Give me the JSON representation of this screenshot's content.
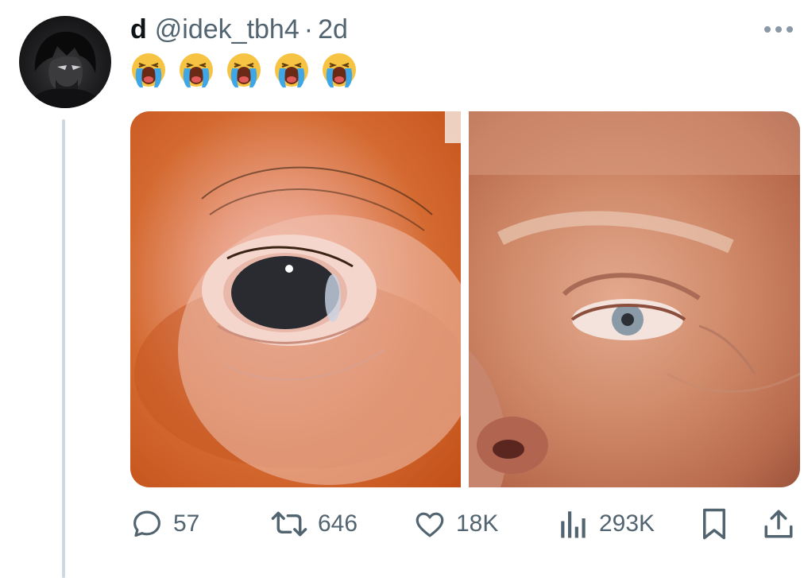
{
  "tweet": {
    "display_name": "d",
    "handle": "@idek_tbh4",
    "separator": "·",
    "time": "2d",
    "emojis": [
      "😭",
      "😭",
      "😭",
      "😭",
      "😭"
    ]
  },
  "actions": {
    "replies": "57",
    "reposts": "646",
    "likes": "18K",
    "views": "293K"
  },
  "colors": {
    "secondary_text": "#536471",
    "thread_line": "#cfd9de"
  },
  "icons": [
    "more-icon",
    "reply-icon",
    "repost-icon",
    "like-icon",
    "views-icon",
    "bookmark-icon",
    "share-icon"
  ]
}
